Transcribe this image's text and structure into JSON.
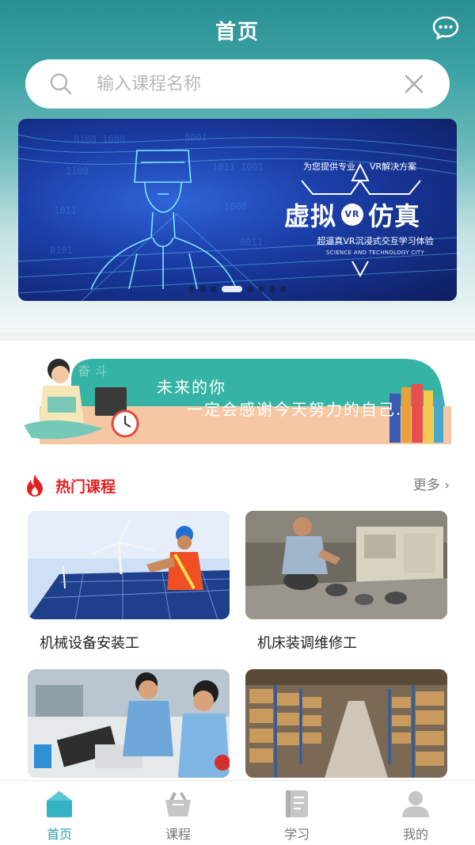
{
  "header": {
    "title": "首页",
    "chat_icon": "chat-bubble-icon"
  },
  "search": {
    "placeholder": "输入课程名称",
    "value": ""
  },
  "banner": {
    "tagline_left": "为您提供专业",
    "tagline_right": "VR解决方案",
    "headline_left": "虚拟",
    "vr_badge": "VR",
    "headline_right": "仿真",
    "subtitle": "超逼真VR沉浸式交互学习体验",
    "english": "SCIENCE AND TECHNOLOGY CITY",
    "slide_count": 8,
    "active_slide": 3
  },
  "motto": {
    "mark": "奋斗",
    "line1": "未来的你",
    "line2": "一定会感谢今天努力的自己."
  },
  "hot": {
    "title": "热门课程",
    "more": "更多 ›"
  },
  "courses": [
    {
      "title": "机械设备安装工"
    },
    {
      "title": "机床装调维修工"
    },
    {
      "title": ""
    },
    {
      "title": ""
    }
  ],
  "tabs": [
    {
      "label": "首页",
      "icon": "home-icon",
      "active": true
    },
    {
      "label": "课程",
      "icon": "basket-icon",
      "active": false
    },
    {
      "label": "学习",
      "icon": "notebook-icon",
      "active": false
    },
    {
      "label": "我的",
      "icon": "user-icon",
      "active": false
    }
  ],
  "colors": {
    "accent": "#2fa3b3",
    "hot_red": "#e41f1f",
    "header_teal": "#2a8f93"
  }
}
